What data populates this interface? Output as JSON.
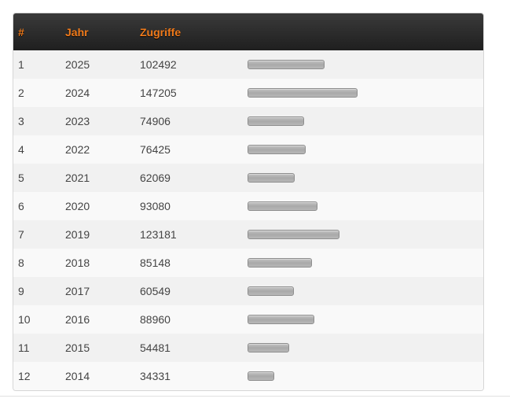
{
  "table": {
    "headers": {
      "num": "#",
      "year": "Jahr",
      "hits": "Zugriffe",
      "bar": ""
    },
    "rows": [
      {
        "num": "1",
        "year": "2025",
        "hits": "102492",
        "value": 102492
      },
      {
        "num": "2",
        "year": "2024",
        "hits": "147205",
        "value": 147205
      },
      {
        "num": "3",
        "year": "2023",
        "hits": "74906",
        "value": 74906
      },
      {
        "num": "4",
        "year": "2022",
        "hits": "76425",
        "value": 76425
      },
      {
        "num": "5",
        "year": "2021",
        "hits": "62069",
        "value": 62069
      },
      {
        "num": "6",
        "year": "2020",
        "hits": "93080",
        "value": 93080
      },
      {
        "num": "7",
        "year": "2019",
        "hits": "123181",
        "value": 123181
      },
      {
        "num": "8",
        "year": "2018",
        "hits": "85148",
        "value": 85148
      },
      {
        "num": "9",
        "year": "2017",
        "hits": "60549",
        "value": 60549
      },
      {
        "num": "10",
        "year": "2016",
        "hits": "88960",
        "value": 88960
      },
      {
        "num": "11",
        "year": "2015",
        "hits": "54481",
        "value": 54481
      },
      {
        "num": "12",
        "year": "2014",
        "hits": "34331",
        "value": 34331
      }
    ]
  },
  "colors": {
    "header_text": "#f07a1a",
    "header_bg": "#262626",
    "bar_fill": "#aaaaaa"
  }
}
